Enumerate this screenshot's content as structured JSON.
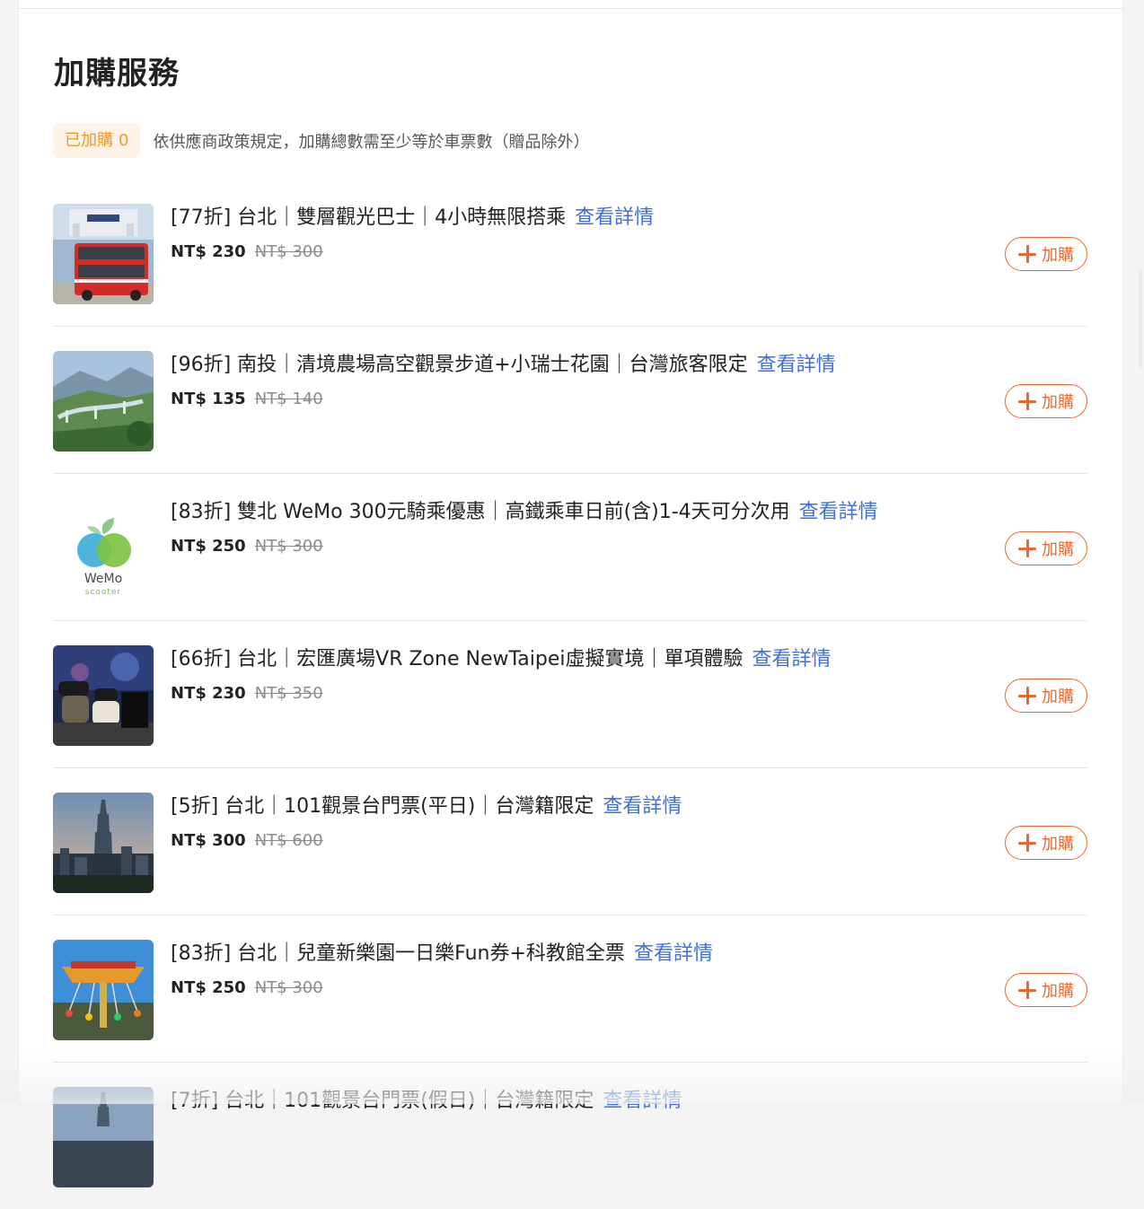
{
  "section": {
    "title": "加購服務",
    "added_label": "已加購",
    "added_count": "0",
    "notice": "依供應商政策規定，加購總數需至少等於車票數（贈品除外）"
  },
  "details_label": "查看詳情",
  "add_label": "加購",
  "items": [
    {
      "title": "[77折] 台北｜雙層觀光巴士｜4小時無限搭乘",
      "price": "NT$ 230",
      "original_price": "NT$ 300"
    },
    {
      "title": "[96折] 南投｜清境農場高空觀景步道+小瑞士花園｜台灣旅客限定",
      "price": "NT$ 135",
      "original_price": "NT$ 140"
    },
    {
      "title": "[83折] 雙北 WeMo 300元騎乘優惠｜高鐵乘車日前(含)1-4天可分次用",
      "price": "NT$ 250",
      "original_price": "NT$ 300",
      "thumb_logo": "WeMo",
      "thumb_sub": "scooter"
    },
    {
      "title": "[66折] 台北｜宏匯廣場VR Zone NewTaipei虛擬實境｜單項體驗",
      "price": "NT$ 230",
      "original_price": "NT$ 350"
    },
    {
      "title": "[5折] 台北｜101觀景台門票(平日)｜台灣籍限定",
      "price": "NT$ 300",
      "original_price": "NT$ 600"
    },
    {
      "title": "[83折] 台北｜兒童新樂園一日樂Fun券+科教館全票",
      "price": "NT$ 250",
      "original_price": "NT$ 300"
    },
    {
      "title": "[7折] 台北｜101觀景台門票(假日)｜台灣籍限定",
      "price": "",
      "original_price": ""
    }
  ],
  "colors": {
    "accent": "#e8682e",
    "link": "#3f6fd8",
    "badge_bg": "#fdf3e6",
    "badge_text": "#ef9a2c"
  }
}
